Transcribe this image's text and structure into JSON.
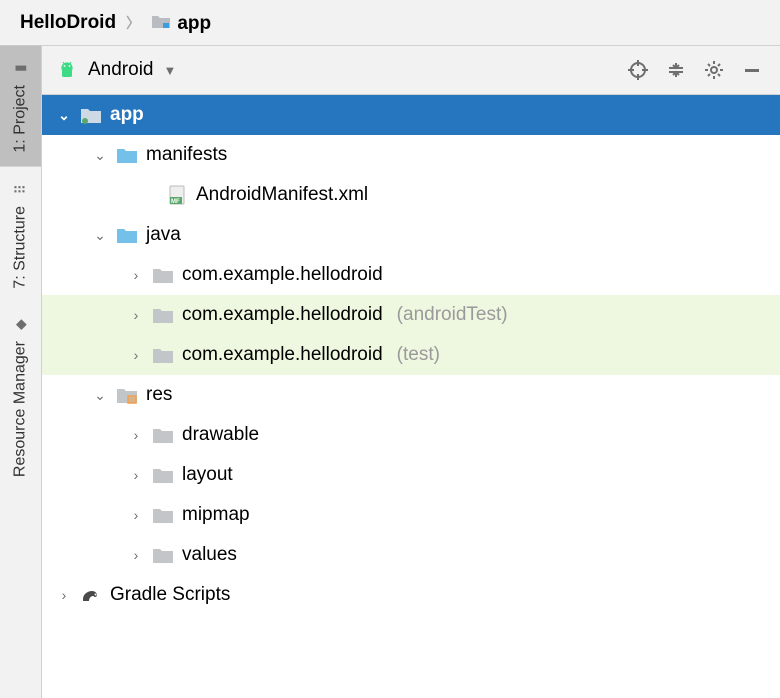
{
  "breadcrumb": {
    "root": "HelloDroid",
    "current": "app"
  },
  "sidebar": {
    "tabs": [
      {
        "label": "1: Project",
        "active": true
      },
      {
        "label": "7: Structure",
        "active": false
      },
      {
        "label": "Resource Manager",
        "active": false
      }
    ]
  },
  "panel": {
    "view_label": "Android"
  },
  "tree": {
    "app": {
      "label": "app",
      "manifests": {
        "label": "manifests",
        "file": "AndroidManifest.xml"
      },
      "java": {
        "label": "java",
        "pkg_main": "com.example.hellodroid",
        "pkg_androidTest": "com.example.hellodroid",
        "pkg_androidTest_suffix": "(androidTest)",
        "pkg_test": "com.example.hellodroid",
        "pkg_test_suffix": "(test)"
      },
      "res": {
        "label": "res",
        "drawable": "drawable",
        "layout": "layout",
        "mipmap": "mipmap",
        "values": "values"
      }
    },
    "gradle": {
      "label": "Gradle Scripts"
    }
  }
}
